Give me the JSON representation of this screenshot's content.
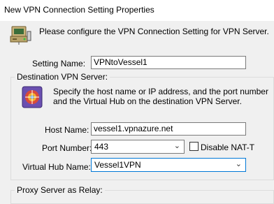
{
  "window": {
    "title": "New VPN Connection Setting Properties"
  },
  "header": {
    "icon": "network-computer-icon",
    "message": "Please configure the VPN Connection Setting for VPN Server."
  },
  "setting_name": {
    "label": "Setting Name:",
    "value": "VPNtoVessel1"
  },
  "destination": {
    "group_title": "Destination VPN Server:",
    "icon": "server-globe-icon",
    "description_line1": "Specify the host name or IP address, and the port number",
    "description_line2": "and the Virtual Hub on the destination VPN Server.",
    "host_name_label": "Host Name:",
    "host_name_value": "vessel1.vpnazure.net",
    "port_label": "Port Number:",
    "port_value": "443",
    "disable_nat_label": "Disable NAT-T",
    "disable_nat_checked": false,
    "hub_label": "Virtual Hub Name:",
    "hub_value": "Vessel1VPN"
  },
  "proxy": {
    "group_title": "Proxy Server as Relay:"
  }
}
